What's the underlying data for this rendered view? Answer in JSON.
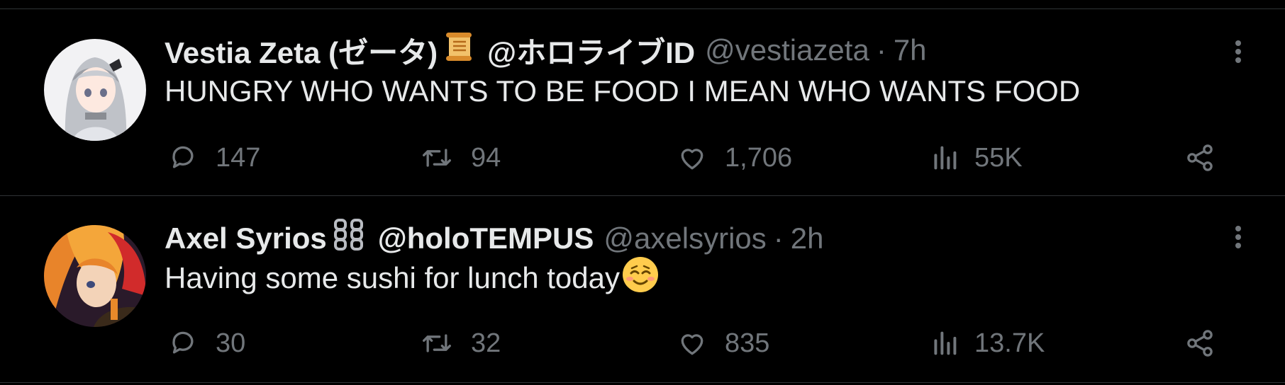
{
  "tweets": [
    {
      "display_name": "Vestia Zeta (ゼータ)",
      "badge_icon": "scroll-icon",
      "affiliation": "@ホロライブID",
      "handle": "@vestiazeta",
      "separator": "·",
      "time": "7h",
      "text": "HUNGRY WHO WANTS TO BE FOOD I MEAN WHO WANTS FOOD",
      "replies": "147",
      "retweets": "94",
      "likes": "1,706",
      "views": "55K"
    },
    {
      "display_name": "Axel Syrios",
      "badge_icon": "chain-icon",
      "affiliation": "@holoTEMPUS",
      "handle": "@axelsyrios",
      "separator": "·",
      "time": "2h",
      "text": "Having some sushi for lunch today",
      "emoji": "relieved-face-emoji",
      "replies": "30",
      "retweets": "32",
      "likes": "835",
      "views": "13.7K"
    }
  ],
  "colors": {
    "background": "#000000",
    "primary_text": "#e7e9ea",
    "secondary_text": "#71767b",
    "divider": "#2f3336"
  }
}
